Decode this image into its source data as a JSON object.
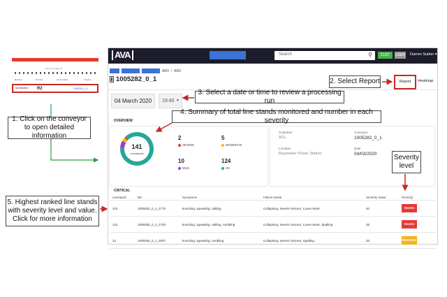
{
  "mini": {
    "filter_text": "Sort by: Priority ▼",
    "headers": [
      "Routing",
      "Position",
      "Last Update",
      "Device"
    ],
    "selected_row": {
      "tag": "14 Severe",
      "id": "R2",
      "link": "1005282_0_1"
    }
  },
  "callouts": {
    "c1": "1. Click on the conveyor to open detailed information",
    "c2": "2. Select Report",
    "c3": "3. Select a date or time to review a processing run",
    "c4": "4. Summary of total line stands monitored and number in each severity",
    "c5": "5. Highest ranked line stands with severity level and value. Click for more information",
    "severity": "Severity level"
  },
  "app": {
    "logo": "AVA",
    "search_placeholder": "Search",
    "cust_label": "CUST",
    "user_label": "USER",
    "username": "Darren Sutton ▾",
    "crumbs": [
      "AR3",
      "AR3"
    ],
    "page_title": "1005282_0_1",
    "tabs": {
      "report": "Report",
      "heatmap": "Heatmap"
    },
    "date": "04 March 2020",
    "time": "19:40"
  },
  "overview": {
    "label": "OVERVIEW",
    "total": "141",
    "total_label": "Linestands",
    "stats": [
      {
        "value": "2",
        "label": "SEVERE",
        "color": "#e53935"
      },
      {
        "value": "5",
        "label": "MODERATE",
        "color": "#f2b418"
      },
      {
        "value": "10",
        "label": "MILD",
        "color": "#9c3fbf"
      },
      {
        "value": "124",
        "label": "OK",
        "color": "#26a69a"
      }
    ],
    "info": {
      "customer_label": "Customer",
      "customer_value": "AGL",
      "conveyor_label": "Conveyor",
      "conveyor_value": "1005282_0_1",
      "location_label": "Location",
      "location_value": "Bayswater Power Station",
      "date_label": "Date",
      "date_value": "04/03/2020"
    }
  },
  "critical": {
    "label": "CRITICAL",
    "headers": [
      "Linestand",
      "Bin",
      "Symptoms",
      "Failure Mode",
      "Severity Value",
      "Severity"
    ],
    "rows": [
      {
        "linestand": "101",
        "bin": "1005282_0_1_1775",
        "symptoms": "knocking, squealing, rattling",
        "failure": "Collapsing, Severe Seizure, Loose Wear",
        "value": "40",
        "severity": "Severe",
        "color": "#e53935"
      },
      {
        "linestand": "141",
        "bin": "1005282_0_1_1703",
        "symptoms": "knocking, squealing, rattling, rumbling",
        "failure": "Collapsing, Severe Seizure, Loose Wear, Spalling",
        "value": "38",
        "severity": "Severe",
        "color": "#e53935"
      },
      {
        "linestand": "12",
        "bin": "1005282_0_1_2007",
        "symptoms": "knocking, squealing, rumbling",
        "failure": "Collapsing, Severe Seizure, Spalling",
        "value": "33",
        "severity": "Moderate",
        "color": "#f2b418"
      }
    ]
  },
  "colors": {
    "accent_red": "#c62828",
    "arrow_green": "#2e9e3a",
    "topbar": "#1c1c2a",
    "nav_blue": "#3c73d5"
  }
}
